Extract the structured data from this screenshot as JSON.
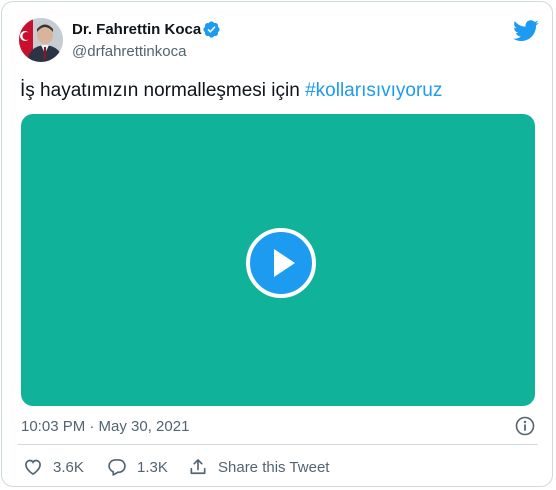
{
  "author": {
    "name": "Dr. Fahrettin Koca",
    "handle": "@drfahrettinkoca",
    "verified": true
  },
  "tweet": {
    "text": "İş hayatımızın normalleşmesi için ",
    "hashtag": "#kollarısıvıyoruz",
    "timestamp": "10:03 PM · May 30, 2021"
  },
  "media": {
    "type": "video",
    "background_color": "#11b29a"
  },
  "actions": {
    "like_count": "3.6K",
    "reply_count": "1.3K",
    "share_label": "Share this Tweet"
  },
  "colors": {
    "accent": "#1d9bf0",
    "text": "#0f1419",
    "secondary_text": "#536471",
    "border": "#cfd9de"
  },
  "icons": [
    "twitter-bird-icon",
    "verified-badge-icon",
    "play-icon",
    "info-icon",
    "heart-icon",
    "reply-icon",
    "share-icon"
  ]
}
